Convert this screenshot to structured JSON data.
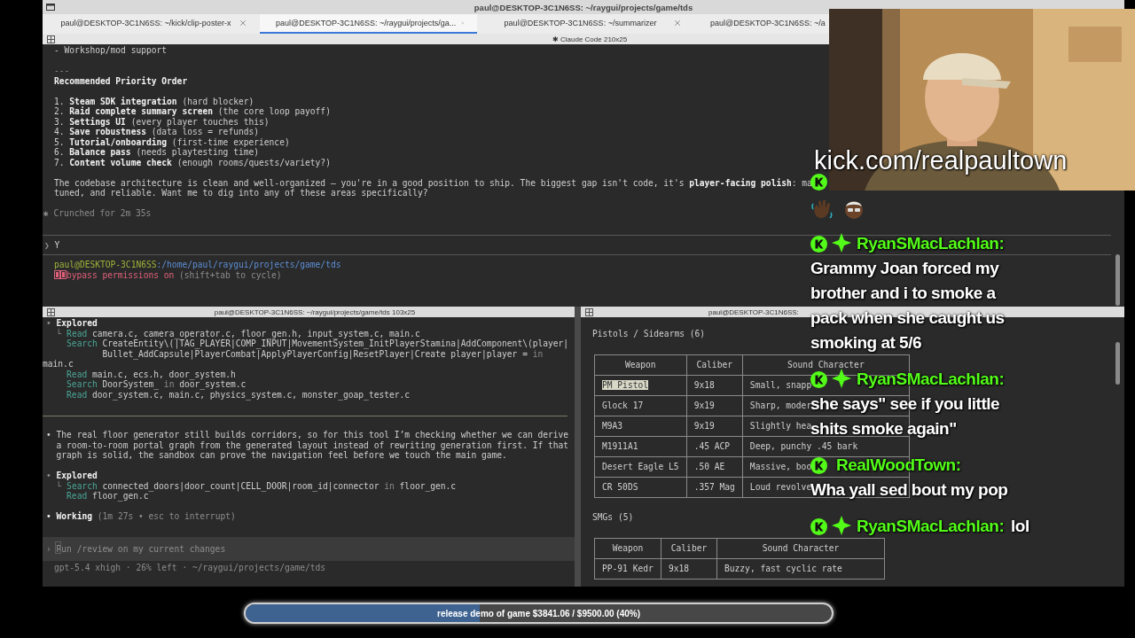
{
  "window": {
    "title": "paul@DESKTOP-3C1N6SS: ~/raygui/projects/game/tds"
  },
  "tabs": [
    {
      "label": "paul@DESKTOP-3C1N6SS: ~/kick/clip-poster-x",
      "selected": false,
      "close": true
    },
    {
      "label": "paul@DESKTOP-3C1N6SS: ~/raygui/projects/ga...",
      "selected": true,
      "close": true
    },
    {
      "label": "paul@DESKTOP-3C1N6SS: ~/summarizer",
      "selected": false,
      "close": true
    },
    {
      "label": "paul@DESKTOP-3C1N6SS: ~/a",
      "selected": false,
      "close": false
    }
  ],
  "terminal": {
    "title": "✱ Claude Code 210x25",
    "bullet": "- Workshop/mod support",
    "divider": "---",
    "heading": "Recommended Priority Order",
    "priorities": [
      "1. **Steam SDK integration** (hard blocker)",
      "2. **Raid complete summary screen** (the core loop payoff)",
      "3. **Settings UI** (every player touches this)",
      "4. **Save robustness** (data loss = refunds)",
      "5. **Tutorial/onboarding** (first-time experience)",
      "6. **Balance pass** (needs playtesting time)",
      "7. **Content volume check** (enough rooms/quests/variety?)"
    ],
    "summary": "The codebase architecture is clean and well-organized — you're in a good position to ship. The biggest gap isn't code, it's **player-facing polish**: ma\ntuned, and reliable. Want me to dig into any of these areas specifically?",
    "status": "✱ Crunched for 2m 35s",
    "prompt": {
      "symbol": "❯",
      "value": "Y"
    },
    "shell": {
      "user": "paul@DESKTOP-3C1N6SS",
      "path": ":/home/paul/raygui/projects/game/tds"
    },
    "mode": {
      "text": "bypass permissions on",
      "hint": "(shift+tab to cycle)"
    }
  },
  "left_pane": {
    "title": "paul@DESKTOP-3C1N6SS: ~/raygui/projects/game/tds 103x25",
    "blocks": [
      {
        "kind": "explored",
        "bullet": "•",
        "title": "Explored",
        "branch": "└",
        "actions": [
          {
            "kind": "read",
            "verb": "Read",
            "files": "camera.c, camera_operator.c, floor_gen.h, input_system.c, main.c"
          },
          {
            "kind": "search_wrapped",
            "verb": "Search",
            "pattern": [
              "CreateEntity\\(|TAG_PLAYER|COMP_INPUT|MovementSystem_InitPlayerStamina|AddComponent\\(player|",
              "Bullet_AddCapsule|PlayerCombat|ApplyPlayerConfig|ResetPlayer|Create player|player ="
            ],
            "in": "in",
            "file": "main.c"
          },
          {
            "kind": "read",
            "verb": "Read",
            "files": "main.c, ecs.h, door_system.h"
          },
          {
            "kind": "search",
            "verb": "Search",
            "pattern": "DoorSystem_",
            "in": "in",
            "file": "door_system.c"
          },
          {
            "kind": "read",
            "verb": "Read",
            "files": "door_system.c, main.c, physics_system.c, monster_goap_tester.c"
          }
        ]
      },
      {
        "kind": "message",
        "bullet": "•",
        "text": "The real floor generator still builds corridors, so for this tool I’m checking whether we can derive a room-to-room portal graph from the generated layout instead of rewriting generation first. If that graph is solid, the sandbox can prove the navigation feel before we touch the main game."
      },
      {
        "kind": "explored",
        "bullet": "•",
        "title": "Explored",
        "branch": "└",
        "actions": [
          {
            "kind": "search",
            "verb": "Search",
            "pattern": "connected_doors|door_count|CELL_DOOR|room_id|connector",
            "in": "in",
            "file": "floor_gen.c"
          },
          {
            "kind": "read",
            "verb": "Read",
            "files": "floor_gen.c"
          }
        ]
      },
      {
        "kind": "working",
        "bullet": "•",
        "title": "Working",
        "detail": "(1m 27s • esc to interrupt)"
      }
    ],
    "input": {
      "symbol": "›",
      "placeholder": "Run /review on my current changes"
    },
    "footer": "gpt-5.4 xhigh · 26% left · ~/raygui/projects/game/tds"
  },
  "right_pane": {
    "title": "paul@DESKTOP-3C1N6SS:",
    "sections": [
      {
        "title": "Pistols / Sidearms (6)",
        "columns": [
          "Weapon",
          "Caliber",
          "Sound Character"
        ],
        "rows": [
          {
            "cells": [
              "PM Pistol",
              "9x18",
              "Small, snapp"
            ],
            "selected": true
          },
          {
            "cells": [
              "Glock 17",
              "9x19",
              "Sharp, moder"
            ],
            "selected": false
          },
          {
            "cells": [
              "M9A3",
              "9x19",
              "Slightly hea"
            ],
            "selected": false
          },
          {
            "cells": [
              "M1911A1",
              ".45 ACP",
              "Deep, punchy .45 bark"
            ],
            "selected": false
          },
          {
            "cells": [
              "Desert Eagle L5",
              ".50 AE",
              "Massive, boo"
            ],
            "selected": false
          },
          {
            "cells": [
              "CR 50DS",
              ".357 Mag",
              "Loud revolve"
            ],
            "selected": false
          }
        ]
      },
      {
        "title": "SMGs (5)",
        "columns": [
          "Weapon",
          "Caliber",
          "Sound Character"
        ],
        "rows": [
          {
            "cells": [
              "PP-91 Kedr",
              "9x18",
              "Buzzy, fast cyclic rate"
            ],
            "selected": false
          }
        ]
      }
    ]
  },
  "stream": {
    "url": "kick.com/realpaultown",
    "chat": [
      {
        "kind": "emotes"
      },
      {
        "kind": "message",
        "user": "RyanSMacLachlan:",
        "supporter": true,
        "text": "Grammy Joan forced my brother and i to smoke a pack when she caught us smoking at 5/6"
      },
      {
        "kind": "message",
        "user": "RyanSMacLachlan:",
        "supporter": true,
        "text": "she says\" see if you little shits smoke again\""
      },
      {
        "kind": "message",
        "user": "RealWoodTown:",
        "supporter": false,
        "text": "Wha yall sed bout my pop"
      },
      {
        "kind": "message",
        "user": "RyanSMacLachlan:",
        "supporter": true,
        "text": "lol"
      }
    ],
    "goal": {
      "text": "release demo of game $3841.06 / $9500.00 (40%)",
      "level": 0.4
    }
  }
}
